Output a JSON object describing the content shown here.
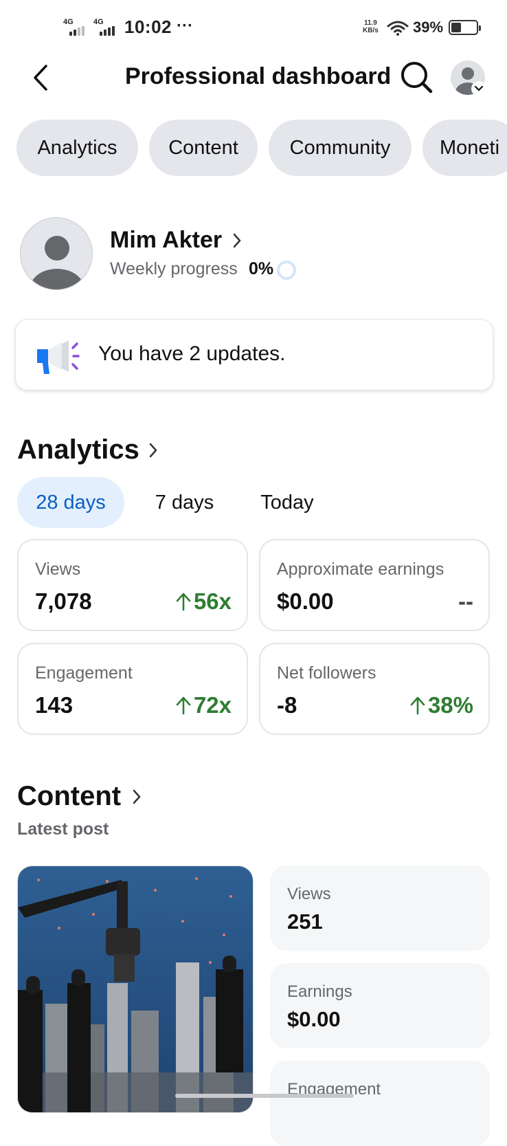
{
  "status_bar": {
    "sim1": "4G",
    "sim2": "4G",
    "time": "10:02",
    "dots": "···",
    "net_speed_value": "11.9",
    "net_speed_unit": "KB/s",
    "battery_percent": "39%",
    "battery_level": 0.39
  },
  "header": {
    "title": "Professional dashboard",
    "back_icon": "chevron-left-icon",
    "search_icon": "search-icon",
    "avatar_icon": "user-avatar-icon"
  },
  "tabs": [
    {
      "label": "Analytics"
    },
    {
      "label": "Content"
    },
    {
      "label": "Community"
    },
    {
      "label": "Moneti"
    }
  ],
  "profile": {
    "name": "Mim Akter",
    "weekly_label": "Weekly progress",
    "weekly_value": "0%"
  },
  "updates": {
    "text": "You have 2 updates.",
    "icon": "megaphone-icon"
  },
  "analytics": {
    "title": "Analytics",
    "ranges": [
      {
        "label": "28 days",
        "active": true
      },
      {
        "label": "7 days",
        "active": false
      },
      {
        "label": "Today",
        "active": false
      }
    ],
    "stats": [
      {
        "label": "Views",
        "value": "7,078",
        "change": "56x",
        "trend": "up"
      },
      {
        "label": "Approximate earnings",
        "value": "$0.00",
        "change": "--",
        "trend": "none"
      },
      {
        "label": "Engagement",
        "value": "143",
        "change": "72x",
        "trend": "up"
      },
      {
        "label": "Net followers",
        "value": "-8",
        "change": "38%",
        "trend": "up"
      }
    ],
    "colors": {
      "positive": "#2e7d32",
      "active_tab_bg": "#e3effd",
      "active_tab_text": "#0a5fc1"
    }
  },
  "content": {
    "title": "Content",
    "latest_post_label": "Latest post",
    "metrics": [
      {
        "label": "Views",
        "value": "251"
      },
      {
        "label": "Earnings",
        "value": "$0.00"
      },
      {
        "label": "Engagement",
        "value": ""
      }
    ]
  }
}
